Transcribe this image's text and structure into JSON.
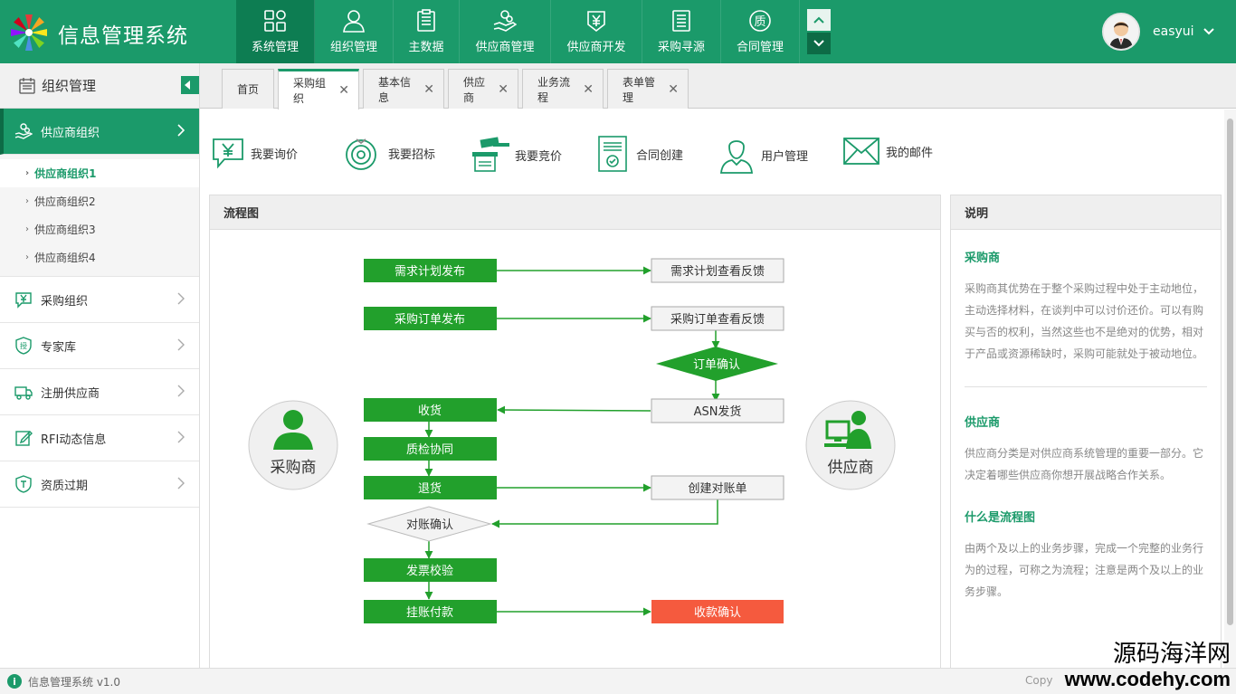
{
  "app": {
    "title": "信息管理系统",
    "version": "信息管理系统 v1.0",
    "copyright": "Copy"
  },
  "colors": {
    "brand": "#1b9a6a",
    "brand_dark": "#0d7d52",
    "flow_green": "#22a02c",
    "flow_red": "#f55a3e"
  },
  "nav": [
    {
      "label": "系统管理",
      "icon": "grid-icon"
    },
    {
      "label": "组织管理",
      "icon": "user-icon"
    },
    {
      "label": "主数据",
      "icon": "clipboard-icon"
    },
    {
      "label": "供应商管理",
      "icon": "hand-coin-icon"
    },
    {
      "label": "供应商开发",
      "icon": "yen-badge-icon"
    },
    {
      "label": "采购寻源",
      "icon": "document-icon"
    },
    {
      "label": "合同管理",
      "icon": "quality-icon"
    }
  ],
  "user": {
    "name": "easyui"
  },
  "sidebar": {
    "title": "组织管理",
    "active_item": "供应商组织",
    "sub_items": [
      "供应商组织1",
      "供应商组织2",
      "供应商组织3",
      "供应商组织4"
    ],
    "items": [
      {
        "label": "采购组织",
        "icon": "yen-chat-icon"
      },
      {
        "label": "专家库",
        "icon": "shield-icon"
      },
      {
        "label": "注册供应商",
        "icon": "truck-icon"
      },
      {
        "label": "RFI动态信息",
        "icon": "edit-icon"
      },
      {
        "label": "资质过期",
        "icon": "badge-icon"
      }
    ]
  },
  "tabs": [
    "首页",
    "采购组织",
    "基本信息",
    "供应商",
    "业务流程",
    "表单管理"
  ],
  "quick_actions": [
    {
      "label": "我要询价",
      "icon": "yen-chat-icon"
    },
    {
      "label": "我要招标",
      "icon": "target-icon"
    },
    {
      "label": "我要竞价",
      "icon": "gavel-icon"
    },
    {
      "label": "合同创建",
      "icon": "contract-icon"
    },
    {
      "label": "用户管理",
      "icon": "user-icon"
    },
    {
      "label": "我的邮件",
      "icon": "mail-icon"
    }
  ],
  "flow": {
    "title": "流程图",
    "buyer": "采购商",
    "supplier": "供应商",
    "left": [
      "需求计划发布",
      "采购订单发布",
      "收货",
      "质检协同",
      "退货",
      "对账确认",
      "发票校验",
      "挂账付款"
    ],
    "right": [
      "需求计划查看反馈",
      "采购订单查看反馈",
      "订单确认",
      "ASN发货",
      "创建对账单",
      "收款确认"
    ]
  },
  "description": {
    "title": "说明",
    "sections": [
      {
        "heading": "采购商",
        "text": "采购商其优势在于整个采购过程中处于主动地位，主动选择材料，在谈判中可以讨价还价。可以有购买与否的权利，当然这些也不是绝对的优势，相对于产品或资源稀缺时，采购可能就处于被动地位。"
      },
      {
        "heading": "供应商",
        "text": "供应商分类是对供应商系统管理的重要一部分。它决定着哪些供应商你想开展战略合作关系。"
      },
      {
        "heading": "什么是流程图",
        "text": "由两个及以上的业务步骤，完成一个完整的业务行为的过程，可称之为流程；注意是两个及以上的业务步骤。"
      }
    ]
  },
  "watermark": {
    "line1": "源码海洋网",
    "line2": "www.codehy.com"
  }
}
